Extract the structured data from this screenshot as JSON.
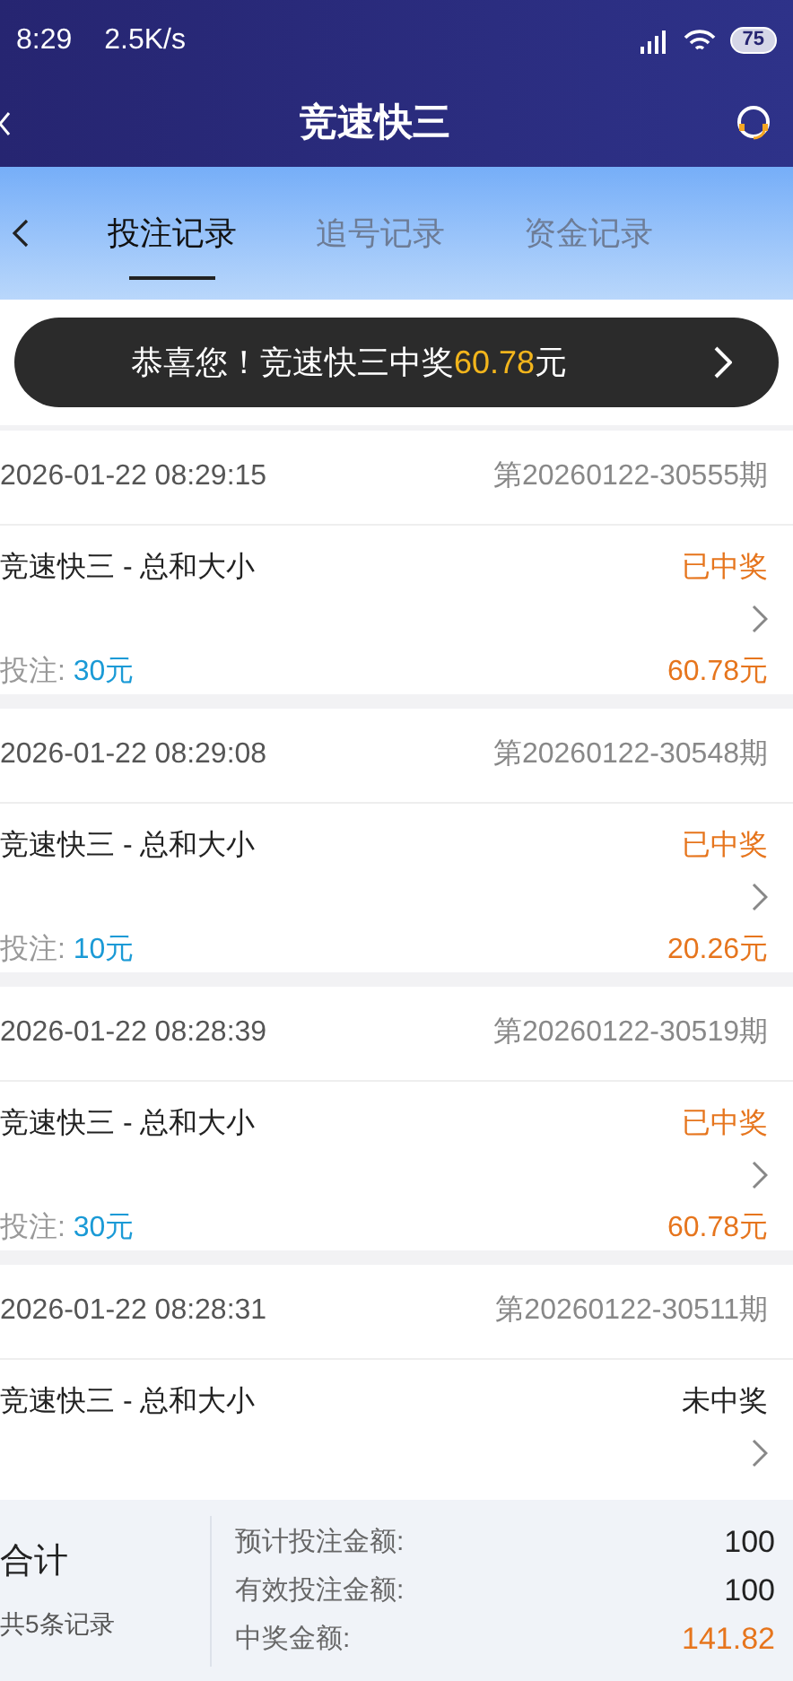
{
  "status_bar": {
    "time": "8:29",
    "speed": "2.5K/s",
    "battery": "75"
  },
  "header": {
    "title": "竞速快三"
  },
  "tabs": [
    {
      "label": "投注记录",
      "selected": true
    },
    {
      "label": "追号记录",
      "selected": false
    },
    {
      "label": "资金记录",
      "selected": false
    }
  ],
  "toast": {
    "text": "恭喜您！竞速快三中奖",
    "amount": "60.78",
    "unit": "元"
  },
  "records": [
    {
      "time": "2026-01-22 08:29:15",
      "issue": "第20260122-30555期",
      "game": "竞速快三 - 总和大小",
      "result": "已中奖",
      "won": true,
      "stake_label": "投注: ",
      "stake": "30元",
      "prize": "60.78元"
    },
    {
      "time": "2026-01-22 08:29:08",
      "issue": "第20260122-30548期",
      "game": "竞速快三 - 总和大小",
      "result": "已中奖",
      "won": true,
      "stake_label": "投注: ",
      "stake": "10元",
      "prize": "20.26元"
    },
    {
      "time": "2026-01-22 08:28:39",
      "issue": "第20260122-30519期",
      "game": "竞速快三 - 总和大小",
      "result": "已中奖",
      "won": true,
      "stake_label": "投注: ",
      "stake": "30元",
      "prize": "60.78元"
    },
    {
      "time": "2026-01-22 08:28:31",
      "issue": "第20260122-30511期",
      "game": "竞速快三 - 总和大小",
      "result": "未中奖",
      "won": false
    }
  ],
  "summary": {
    "title": "合计",
    "count": "共5条记录",
    "rows": [
      {
        "label": "预计投注金额:",
        "value": "100",
        "kind": "plain"
      },
      {
        "label": "有效投注金额:",
        "value": "100",
        "kind": "plain"
      },
      {
        "label": "中奖金额:",
        "value": "141.82",
        "kind": "prize"
      }
    ]
  }
}
